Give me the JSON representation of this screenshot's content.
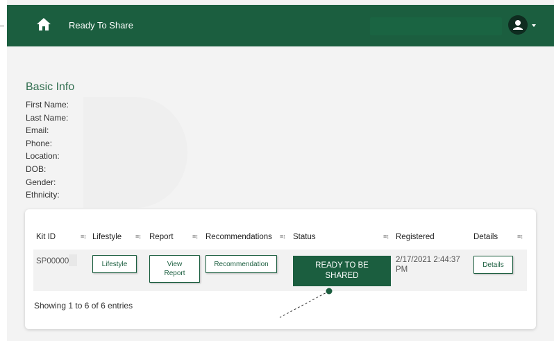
{
  "navbar": {
    "title": "Ready To Share",
    "home_icon": "home-icon",
    "user_icon": "user-avatar-icon",
    "colors": {
      "primary": "#1b5e3f",
      "dark": "#0f2c20"
    }
  },
  "basic_info": {
    "title": "Basic Info",
    "fields": [
      "First Name:",
      "Last Name:",
      "Email:",
      "Phone:",
      "Location:",
      "DOB:",
      "Gender:",
      "Ethnicity:"
    ]
  },
  "table": {
    "headers": [
      "Kit ID",
      "Lifestyle",
      "Report",
      "Recommendations",
      "Status",
      "Registered",
      "Details"
    ],
    "row": {
      "kit_id": "SP00000",
      "lifestyle_button": "Lifestyle",
      "report_button": "View\nReport",
      "recommendation_button": "Recommendation",
      "status_button": "READY TO BE\nSHARED",
      "registered": "2/17/2021 2:44:37 PM",
      "details_button": "Details"
    },
    "footer": "Showing 1 to 6 of 6 entries"
  }
}
